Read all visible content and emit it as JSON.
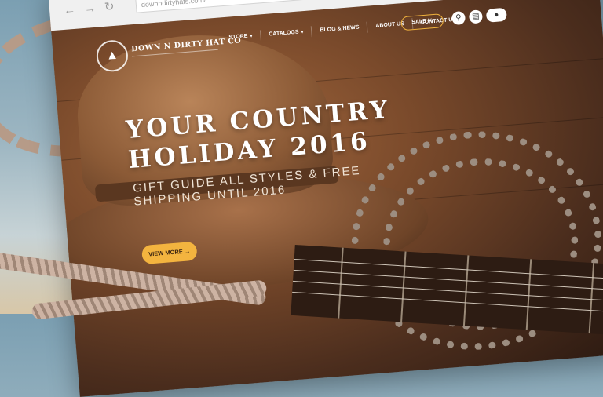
{
  "browser": {
    "url": "downndirtyhats.com/",
    "back_icon": "arrow-left-icon",
    "forward_icon": "arrow-right-icon",
    "reload_icon": "reload-icon"
  },
  "site": {
    "brand": "DOWN N DIRTY HAT CO",
    "logo_icon": "cowboy-hat-icon",
    "nav": [
      {
        "label": "STORE",
        "has_dropdown": true
      },
      {
        "label": "CATALOGS",
        "has_dropdown": true
      },
      {
        "label": "BLOG & NEWS",
        "has_dropdown": false
      },
      {
        "label": "ABOUT US",
        "has_dropdown": false
      },
      {
        "label": "CONTACT US",
        "has_dropdown": false
      }
    ],
    "sale_label": "SALE %",
    "header_icons": [
      "search-icon",
      "cart-icon",
      "account-icon"
    ],
    "hero": {
      "title_line1": "YOUR COUNTRY",
      "title_line2": "HOLIDAY 2016",
      "subtitle_line1": "GIFT GUIDE ALL STYLES & FREE",
      "subtitle_line2": "SHIPPING UNTIL 2016",
      "cta_label": "VIEW MORE",
      "cta_arrow": "→"
    }
  },
  "colors": {
    "accent": "#f3b43f",
    "wood_dark": "#3a2418",
    "sky": "#8fadbd"
  }
}
